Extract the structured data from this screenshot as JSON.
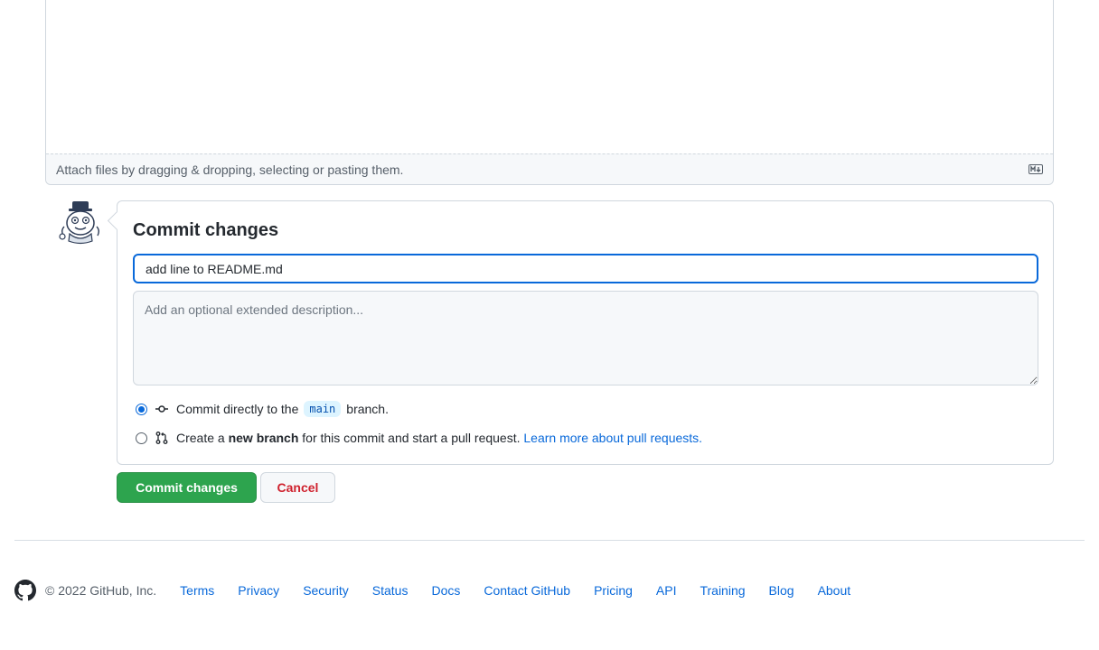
{
  "editor": {
    "attach_hint": "Attach files by dragging & dropping, selecting or pasting them.",
    "markdown_icon": "markdown-icon"
  },
  "avatar": {
    "icon": "avatar-octocat"
  },
  "commit": {
    "title": "Commit changes",
    "summary_value": "add line to README.md",
    "description_placeholder": "Add an optional extended description...",
    "option_direct": {
      "prefix": "Commit directly to the",
      "branch": "main",
      "suffix": "branch.",
      "icon": "git-commit-icon",
      "checked": true
    },
    "option_new_branch": {
      "prefix": "Create a",
      "bold": "new branch",
      "suffix": "for this commit and start a pull request.",
      "link": "Learn more about pull requests.",
      "icon": "git-pull-request-icon",
      "checked": false
    }
  },
  "buttons": {
    "commit": "Commit changes",
    "cancel": "Cancel"
  },
  "footer": {
    "copyright": "© 2022 GitHub, Inc.",
    "links": [
      "Terms",
      "Privacy",
      "Security",
      "Status",
      "Docs",
      "Contact GitHub",
      "Pricing",
      "API",
      "Training",
      "Blog",
      "About"
    ]
  },
  "colors": {
    "primary_green": "#2da44e",
    "link_blue": "#0969da",
    "danger_red": "#cf222e"
  }
}
